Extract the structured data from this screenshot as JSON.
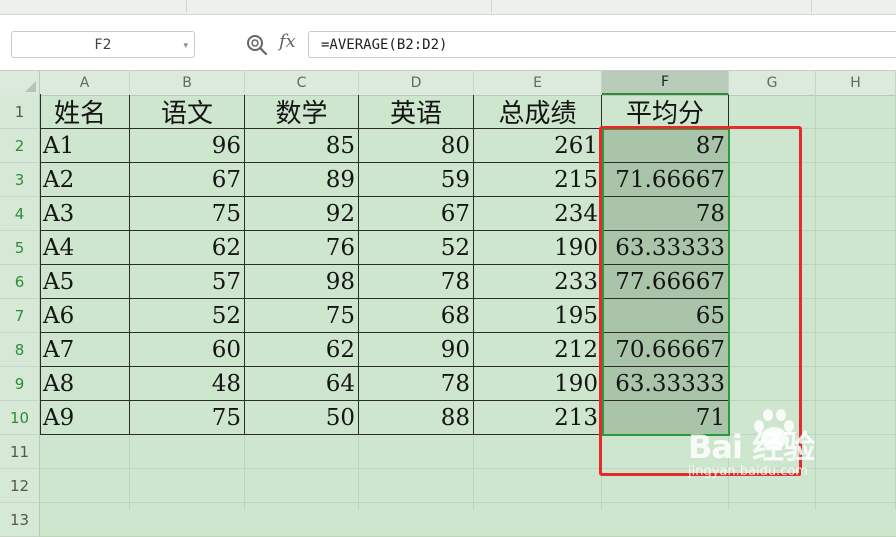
{
  "formula_bar": {
    "name_box": "F2",
    "fx_label": "fx",
    "formula": "=AVERAGE(B2:D2)"
  },
  "columns": [
    "A",
    "B",
    "C",
    "D",
    "E",
    "F",
    "G",
    "H"
  ],
  "rows": [
    "1",
    "2",
    "3",
    "4",
    "5",
    "6",
    "7",
    "8",
    "9",
    "10",
    "11",
    "12",
    "13"
  ],
  "table": {
    "headers": [
      "姓名",
      "语文",
      "数学",
      "英语",
      "总成绩",
      "平均分"
    ],
    "rows": [
      [
        "A1",
        "96",
        "85",
        "80",
        "261",
        "87"
      ],
      [
        "A2",
        "67",
        "89",
        "59",
        "215",
        "71.66667"
      ],
      [
        "A3",
        "75",
        "92",
        "67",
        "234",
        "78"
      ],
      [
        "A4",
        "62",
        "76",
        "52",
        "190",
        "63.33333"
      ],
      [
        "A5",
        "57",
        "98",
        "78",
        "233",
        "77.66667"
      ],
      [
        "A6",
        "52",
        "75",
        "68",
        "195",
        "65"
      ],
      [
        "A7",
        "60",
        "62",
        "90",
        "212",
        "70.66667"
      ],
      [
        "A8",
        "48",
        "64",
        "78",
        "190",
        "63.33333"
      ],
      [
        "A9",
        "75",
        "50",
        "88",
        "213",
        "71"
      ]
    ]
  },
  "selected_column": "F",
  "colors": {
    "sheet_background": "#cde6cd",
    "selection": "#2e9a3e",
    "annotation_box": "#e42a2a",
    "selected_cells": "#a9c4a9"
  },
  "watermark": {
    "main": "Bai  经验",
    "sub": "jingyan.baidu.com"
  }
}
